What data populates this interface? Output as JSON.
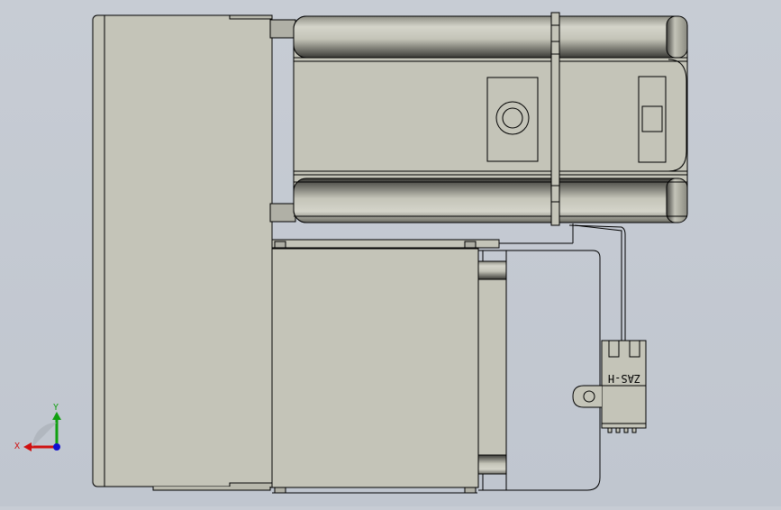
{
  "viewport": {
    "background_color": "#c3c9d1",
    "part_fill": "#c4c4b8",
    "edge_color": "#000000"
  },
  "triad": {
    "x_label": "X",
    "y_label": "Y",
    "x_color": "#d01010",
    "y_color": "#10a010",
    "z_color": "#1010d0"
  },
  "connector": {
    "label": "ZAS-H"
  }
}
